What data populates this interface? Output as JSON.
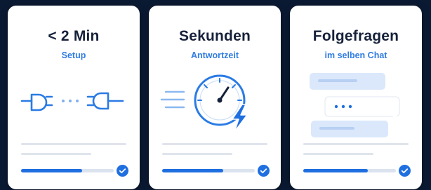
{
  "colors": {
    "background": "#0b1a33",
    "card": "#ffffff",
    "title": "#16213a",
    "accent": "#2f7de1",
    "progress": "#1f6fe0",
    "placeholder_line": "#dfe4ec"
  },
  "cards": [
    {
      "title": "< 2 Min",
      "subtitle": "Setup",
      "icon": "plug-connect-icon",
      "progress": 0.66,
      "status_icon": "check-circle-icon"
    },
    {
      "title": "Sekunden",
      "subtitle": "Antwortzeit",
      "icon": "stopwatch-lightning-icon",
      "progress": 0.66,
      "status_icon": "check-circle-icon"
    },
    {
      "title": "Folgefragen",
      "subtitle": "im selben Chat",
      "icon": "chat-bubbles-icon",
      "progress": 0.7,
      "status_icon": "check-circle-icon"
    }
  ]
}
